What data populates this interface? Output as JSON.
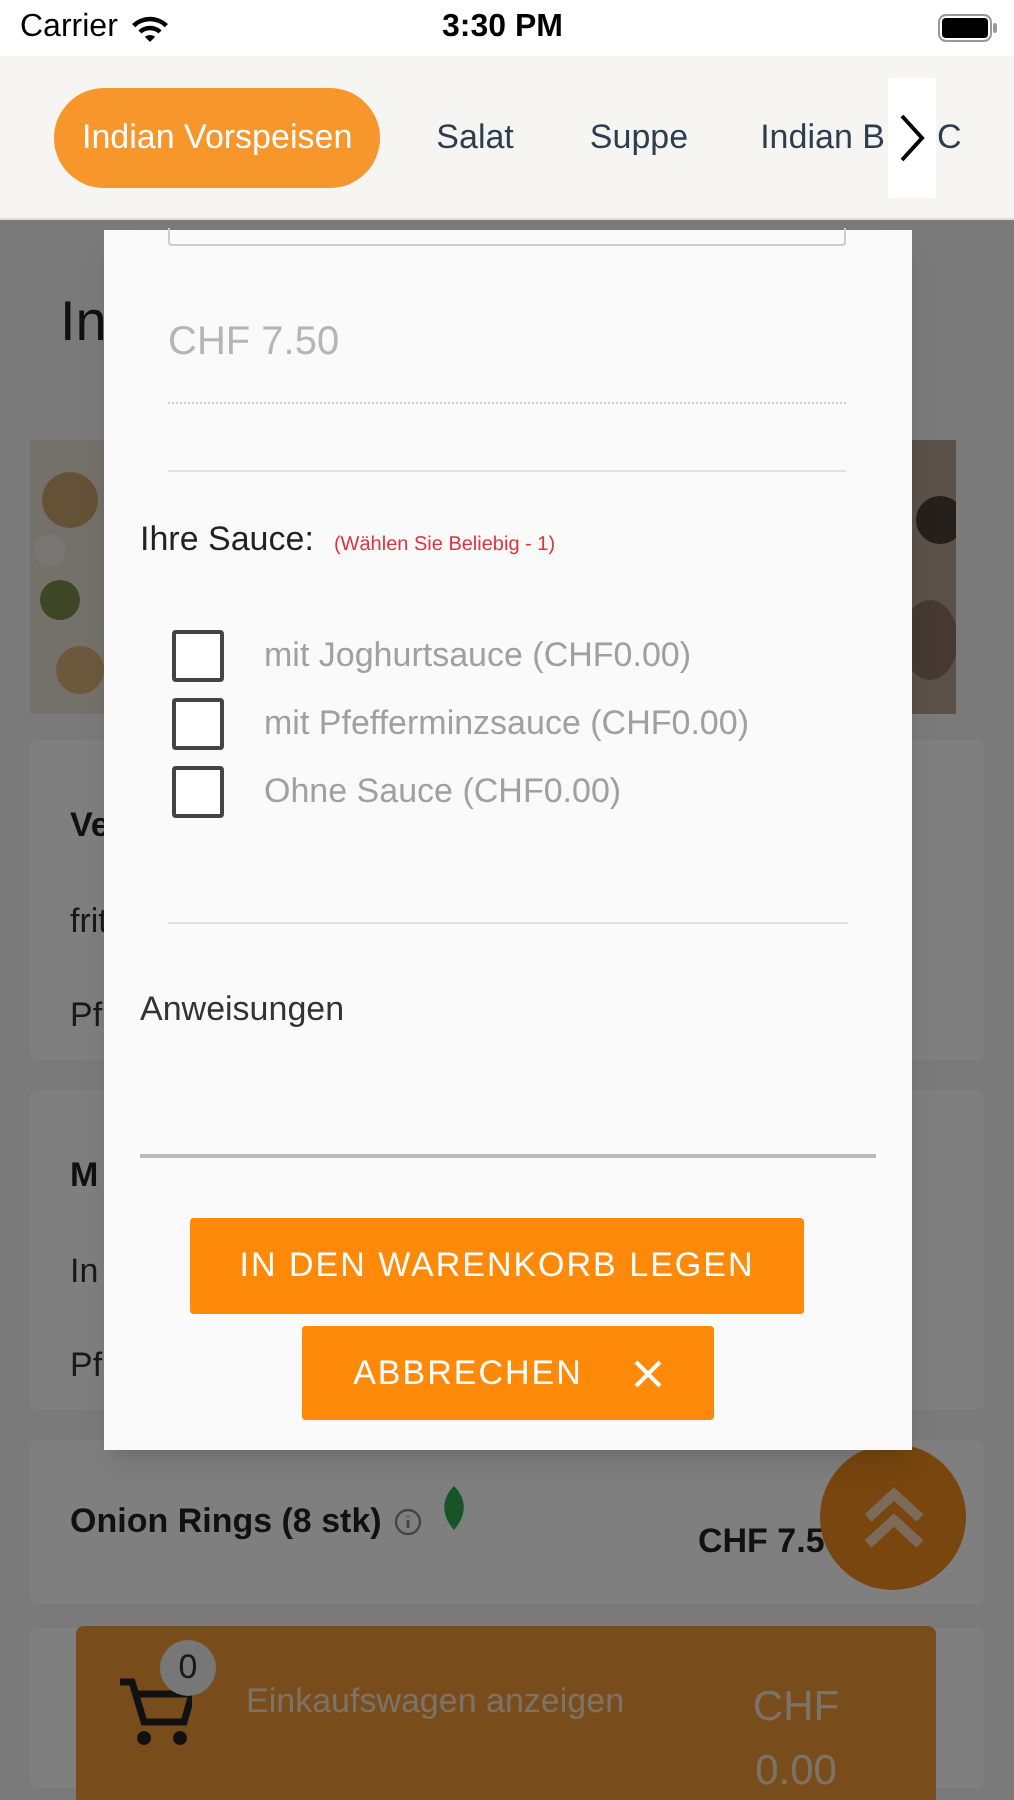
{
  "status_bar": {
    "carrier": "Carrier",
    "time": "3:30 PM"
  },
  "category_tabs": [
    {
      "label": "Indian Vorspeisen",
      "selected": true
    },
    {
      "label": "Salat",
      "selected": false
    },
    {
      "label": "Suppe",
      "selected": false
    },
    {
      "label": "Indian B",
      "selected": false
    },
    {
      "label": "C",
      "selected": false
    }
  ],
  "background": {
    "heading": "In",
    "cards": [
      {
        "kind": "picture"
      },
      {
        "kind": "text",
        "lines": [
          "Ve",
          "frit",
          "Pf"
        ]
      },
      {
        "kind": "text",
        "lines": [
          "M",
          "In",
          "Pf"
        ]
      },
      {
        "kind": "item",
        "name": "Onion Rings (8 stk)",
        "price": "CHF 7.5"
      },
      {
        "kind": "blank"
      }
    ]
  },
  "modal": {
    "price": "CHF 7.50",
    "sauce_label": "Ihre Sauce:",
    "sauce_note": "(Wählen Sie Beliebig - 1)",
    "options": [
      {
        "label": "mit Joghurtsauce (CHF0.00)",
        "checked": false
      },
      {
        "label": "mit Pfefferminzsauce (CHF0.00)",
        "checked": false
      },
      {
        "label": "Ohne Sauce (CHF0.00)",
        "checked": false
      }
    ],
    "instructions_label": "Anweisungen",
    "add_button": "IN DEN WARENKORB LEGEN",
    "cancel_button": "ABBRECHEN"
  },
  "cart_bar": {
    "count": "0",
    "label": "Einkaufswagen anzeigen",
    "total": "CHF 0.00"
  }
}
